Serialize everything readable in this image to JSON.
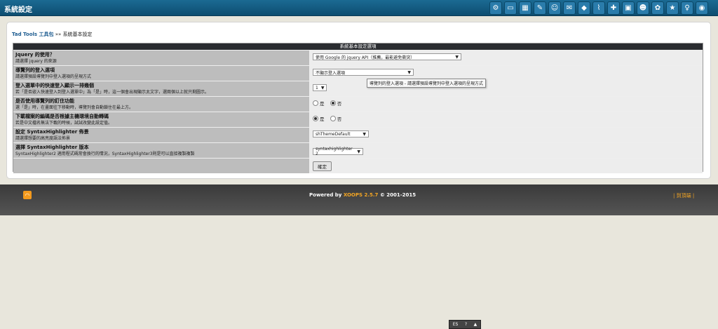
{
  "topbar": {
    "title": "系統設定"
  },
  "toolbar_icons": [
    "settings-icon",
    "monitor-icon",
    "blocks-icon",
    "pen-icon",
    "people-icon",
    "mail-icon",
    "diamond-icon",
    "broom-icon",
    "puzzle-icon",
    "picture-icon",
    "smile-icon",
    "gear-icon",
    "star-icon",
    "key-icon",
    "xoops-icon"
  ],
  "breadcrumb": {
    "parent": "Tad Tools 工具包",
    "separator": "»»",
    "current": "系統基本設定"
  },
  "table": {
    "header": "系統基本設定選項",
    "rows": [
      {
        "title": "Jquery 的使用？",
        "desc": "請選擇 jquery 的來源",
        "control": "select",
        "value": "使用 Google 的 jquery API（推薦，最能避免衝突）"
      },
      {
        "title": "導覽列的登入選項",
        "desc": "請選擇預設導覽列中登入選項的呈現方式",
        "control": "select",
        "value": "不顯示登入選項",
        "tooltip": "導覽列的登入選項 - 請選擇預設導覽列中登入選項的呈現方式"
      },
      {
        "title": "登入選單中的快速登入顯示一排幾個",
        "desc": "若「是否嵌入快速登入到登入選單中」為「是」時，這一個會出現顯示太文字，選兩個以上就只剩圖示。",
        "control": "select",
        "value": "1"
      },
      {
        "title": "是否使用導覽列的釘住功能",
        "desc": "選「是」時，在畫面往下移動時，導覽列會自動鎖住在最上方。",
        "control": "radio",
        "options": [
          "是",
          "否"
        ],
        "selected": 1
      },
      {
        "title": "下載檔案的編碼是否根據主機環境自動轉碼",
        "desc": "若是中文檔名無法下載的時候，試試改變此設定值。",
        "control": "radio",
        "options": [
          "是",
          "否"
        ],
        "selected": 0
      },
      {
        "title": "設定 SyntaxHighlighter 佈景",
        "desc": "請選擇想要的高亮度語法佈景",
        "control": "select",
        "value": "shThemeDefault"
      },
      {
        "title": "選擇 SyntaxHighlighter 版本",
        "desc": "SyntaxHighlighter2 適用程式碼常會換行的情況，SyntaxHighlighter3則是可以直接複製複製",
        "control": "select",
        "value": "syntaxhighlighter 2"
      }
    ],
    "submit_label": "確定"
  },
  "footer": {
    "powered_prefix": "Powered by",
    "xoops": "XOOPS 2.5.7",
    "suffix": "© 2001-2015",
    "right_open": "|",
    "right_link": "到頂端",
    "right_close": "|"
  },
  "taskbar": {
    "left": "ES",
    "mid": "?",
    "right": "▲"
  }
}
